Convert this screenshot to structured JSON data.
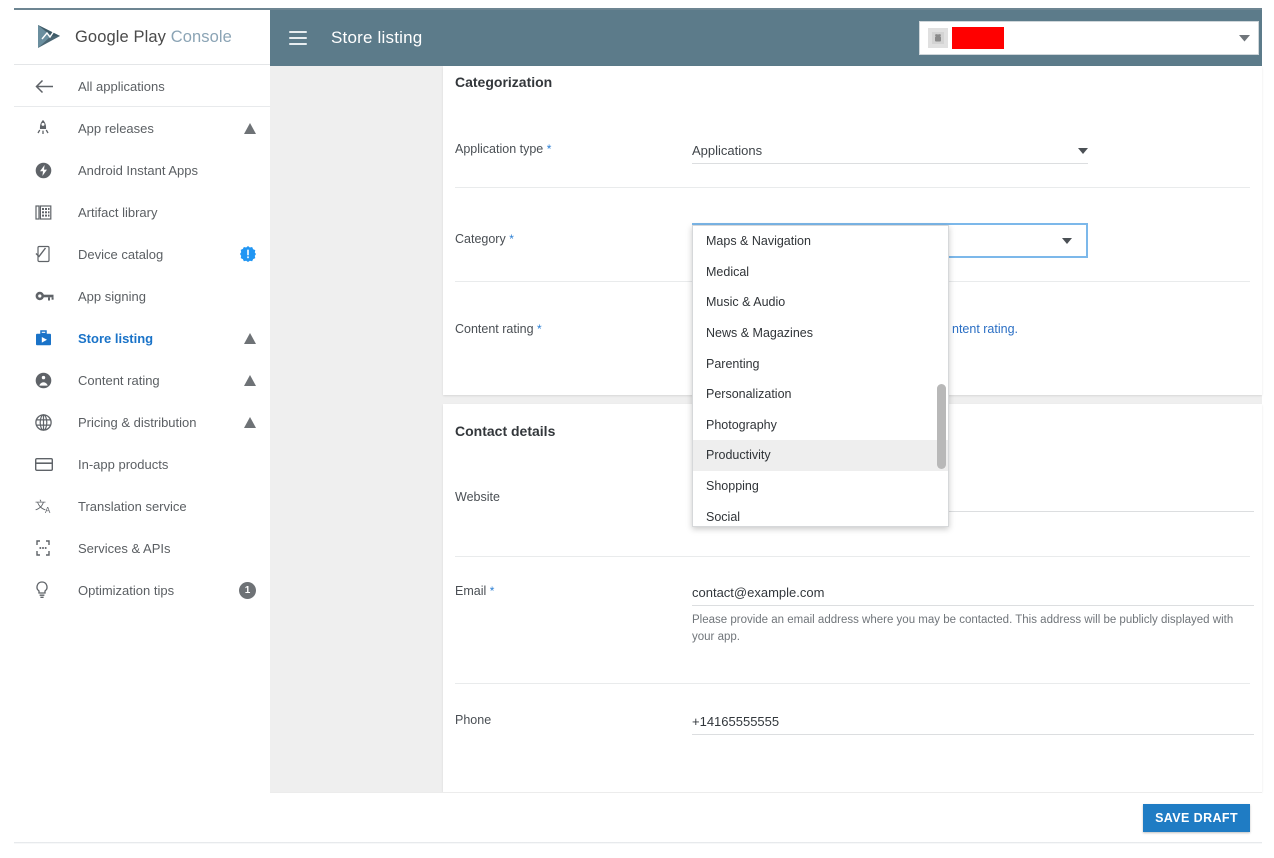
{
  "brand": {
    "name_part1": "Google Play",
    "name_part2": "Console",
    "logo_icon": "google-play-logo"
  },
  "topbar": {
    "menu_icon": "hamburger-menu-icon",
    "title": "Store listing",
    "app_selector": {
      "avatar_icon": "android-app-icon",
      "value": "",
      "caret_icon": "chevron-down-icon"
    }
  },
  "sidebar": {
    "back": {
      "label": "All applications",
      "icon": "arrow-left-icon"
    },
    "items": [
      {
        "label": "App releases",
        "icon": "rocket-icon",
        "trail": "warning"
      },
      {
        "label": "Android Instant Apps",
        "icon": "bolt-circle-icon",
        "trail": ""
      },
      {
        "label": "Artifact library",
        "icon": "library-icon",
        "trail": ""
      },
      {
        "label": "Device catalog",
        "icon": "device-check-icon",
        "trail": "alert"
      },
      {
        "label": "App signing",
        "icon": "key-icon",
        "trail": ""
      },
      {
        "label": "Store listing",
        "icon": "store-bag-icon",
        "trail": "warning",
        "active": true
      },
      {
        "label": "Content rating",
        "icon": "rating-face-icon",
        "trail": "warning"
      },
      {
        "label": "Pricing & distribution",
        "icon": "globe-icon",
        "trail": "warning"
      },
      {
        "label": "In-app products",
        "icon": "card-icon",
        "trail": ""
      },
      {
        "label": "Translation service",
        "icon": "translate-icon",
        "trail": ""
      },
      {
        "label": "Services & APIs",
        "icon": "braces-icon",
        "trail": ""
      },
      {
        "label": "Optimization tips",
        "icon": "bulb-icon",
        "trail": "count",
        "count": "1"
      }
    ]
  },
  "categorization": {
    "title": "Categorization",
    "application_type": {
      "label": "Application type",
      "required_marker": "*",
      "value": "Applications",
      "caret_icon": "chevron-down-icon"
    },
    "category": {
      "label": "Category",
      "required_marker": "*",
      "value": "",
      "caret_icon": "chevron-down-icon",
      "focused": true
    },
    "content_rating": {
      "label": "Content rating",
      "required_marker": "*",
      "helper_visible_fragment": "ntent rating."
    }
  },
  "category_dropdown": {
    "open": true,
    "highlighted": "Productivity",
    "options": [
      "Maps & Navigation",
      "Medical",
      "Music & Audio",
      "News & Magazines",
      "Parenting",
      "Personalization",
      "Photography",
      "Productivity",
      "Shopping",
      "Social"
    ]
  },
  "contact_details": {
    "title": "Contact details",
    "website": {
      "label": "Website",
      "value": ""
    },
    "email": {
      "label": "Email",
      "required_marker": "*",
      "value": "contact@example.com",
      "helper": "Please provide an email address where you may be contacted. This address will be publicly displayed with your app."
    },
    "phone": {
      "label": "Phone",
      "value": "+14165555555"
    }
  },
  "action_bar": {
    "save_label": "SAVE DRAFT"
  },
  "colors": {
    "topbar": "#5c7b8a",
    "accent_blue": "#1a73c8",
    "button_blue": "#1f7cc4",
    "content_bg": "#efefef",
    "redaction": "#ff0000"
  }
}
